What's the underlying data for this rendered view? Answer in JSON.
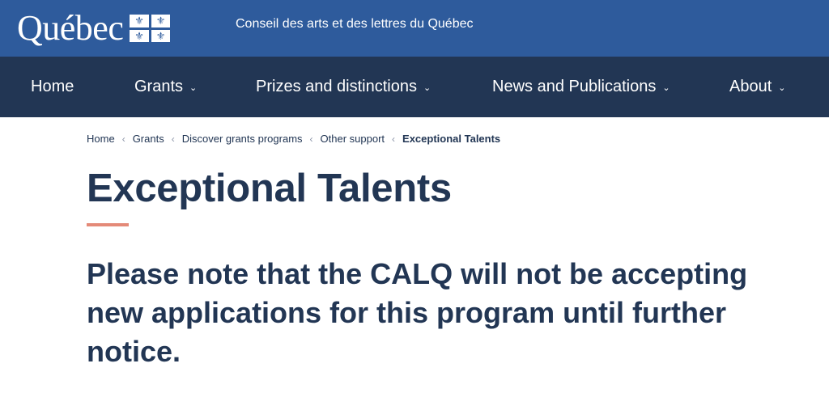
{
  "header": {
    "logo_text": "Québec",
    "council_name": "Conseil des arts et des lettres du Québec"
  },
  "nav": {
    "items": [
      {
        "label": "Home",
        "has_dropdown": false
      },
      {
        "label": "Grants",
        "has_dropdown": true
      },
      {
        "label": "Prizes and distinctions",
        "has_dropdown": true
      },
      {
        "label": "News and Publications",
        "has_dropdown": true
      },
      {
        "label": "About",
        "has_dropdown": true
      }
    ]
  },
  "breadcrumb": {
    "items": [
      "Home",
      "Grants",
      "Discover grants programs",
      "Other support"
    ],
    "current": "Exceptional Talents",
    "separator": "‹"
  },
  "page": {
    "title": "Exceptional Talents",
    "notice": "Please note that the CALQ will not be accepting new applications for this program until further notice."
  },
  "colors": {
    "header_bg": "#2e5b9c",
    "nav_bg": "#223654",
    "accent": "#e48a78",
    "text": "#223654"
  }
}
